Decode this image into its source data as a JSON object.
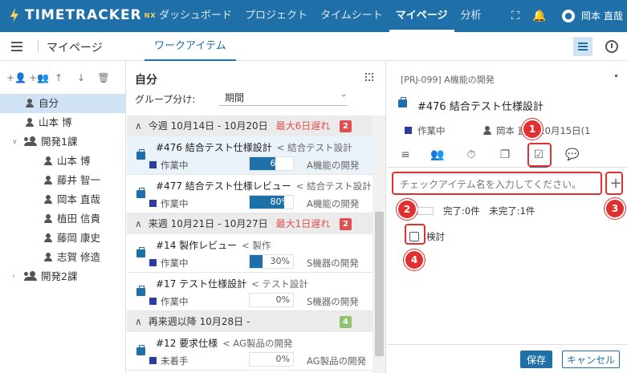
{
  "app": {
    "logo": "TIMETRACKER",
    "logo_suffix": "NX"
  },
  "nav": [
    "ダッシュボード",
    "プロジェクト",
    "タイムシート",
    "マイページ",
    "分析"
  ],
  "user": {
    "name": "岡本 直哉"
  },
  "page": {
    "title": "マイページ",
    "tab": "ワークアイテム"
  },
  "tree": {
    "self": "自分",
    "items": [
      "山本 博",
      "開発1課",
      "山本 博",
      "藤井 智一",
      "岡本 直哉",
      "植田 信貴",
      "藤岡 康史",
      "志賀 修造",
      "開発2課"
    ]
  },
  "mid": {
    "heading": "自分",
    "group_label": "グループ分け:",
    "group_value": "期間",
    "groups": [
      {
        "title": "今週 10月14日 - 10月20日",
        "late": "最大6日遅れ",
        "count": "2",
        "badge_color": "#e05050"
      },
      {
        "title": "来週 10月21日 - 10月27日",
        "late": "最大1日遅れ",
        "count": "2",
        "badge_color": "#e05050"
      },
      {
        "title": "再来週以降 10月28日 -",
        "late": "",
        "count": "4",
        "badge_color": "#8dc26f"
      }
    ],
    "items": [
      {
        "title": "#476 結合テスト仕様設計",
        "parent": "< 結合テスト設計",
        "status": "作業中",
        "progress": "60%",
        "progress_value": 60,
        "project": "A機能の開発"
      },
      {
        "title": "#477 結合テスト仕様レビュー",
        "parent": "< 結合テスト設計",
        "status": "作業中",
        "progress": "80%",
        "progress_value": 80,
        "project": "A機能の開発"
      },
      {
        "title": "#14 製作レビュー",
        "parent": "< 製作",
        "status": "作業中",
        "progress": "30%",
        "progress_value": 30,
        "project": "S機器の開発"
      },
      {
        "title": "#17 テスト仕様設計",
        "parent": "< テスト設計",
        "status": "作業中",
        "progress": "0%",
        "progress_value": 0,
        "project": "S機器の開発"
      },
      {
        "title": "#12 要求仕様",
        "parent": "< AG製品の開発",
        "status": "未着手",
        "progress": "0%",
        "progress_value": 0,
        "project": "AG製品の開発"
      }
    ]
  },
  "detail": {
    "project": "[PRJ-099] A機能の開発",
    "title": "#476 結合テスト仕様設計",
    "status": "作業中",
    "person_date": "岡本 直哉 10月15日(1",
    "checklist_placeholder": "チェックアイテム名を入力してください。",
    "done": "完了:0件",
    "undone": "未完了:1件",
    "check_item": "検討",
    "save": "保存",
    "cancel": "キャンセル"
  },
  "callouts": [
    "1",
    "2",
    "3",
    "4"
  ],
  "colors": {
    "brand": "#1f6fa8",
    "danger": "#e03030",
    "status": "#2b3d9e"
  }
}
